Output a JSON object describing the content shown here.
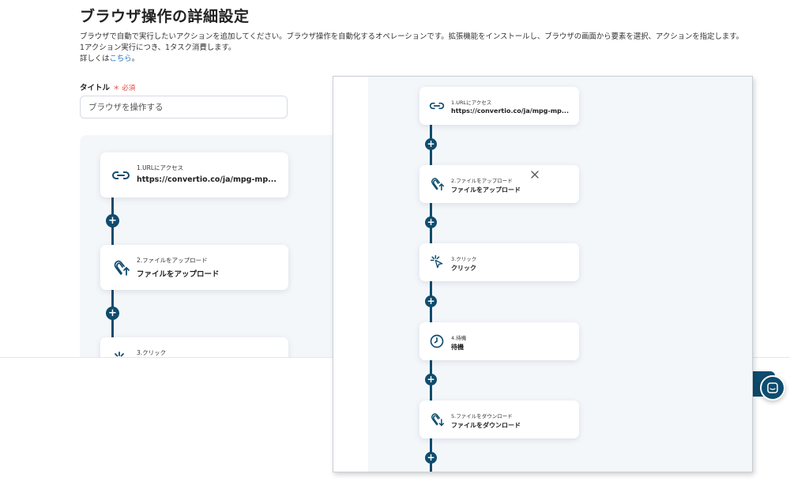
{
  "page": {
    "title": "ブラウザ操作の詳細設定",
    "description_lines": [
      "ブラウザで自動で実行したいアクションを追加してください。ブラウザ操作を自動化するオペレーションです。拡張機能をインストールし、ブラウザの画面から要素を選択、アクションを指定します。",
      "1アクション実行につき、1タスク消費します。"
    ],
    "details_prefix": "詳しくは",
    "details_link": "こちら",
    "details_suffix": "。"
  },
  "form": {
    "title_label": "タイトル",
    "required_mark": "＊ 必須",
    "title_value": "ブラウザを操作する"
  },
  "add_label": "+",
  "left_flow": {
    "steps": [
      {
        "num": "1.URLにアクセス",
        "name": "https://convertio.co/ja/mpg-mp...",
        "icon": "link-icon"
      },
      {
        "num": "2.ファイルをアップロード",
        "name": "ファイルをアップロード",
        "icon": "paperclip-upload-icon"
      },
      {
        "num": "3.クリック",
        "name": "",
        "icon": "click-icon"
      }
    ]
  },
  "overlay_flow": {
    "steps": [
      {
        "num": "1.URLにアクセス",
        "name": "https://convertio.co/ja/mpg-mp...",
        "icon": "link-icon"
      },
      {
        "num": "2.ファイルをアップロード",
        "name": "ファイルをアップロード",
        "icon": "paperclip-upload-icon"
      },
      {
        "num": "3.クリック",
        "name": "クリック",
        "icon": "click-icon"
      },
      {
        "num": "4.待機",
        "name": "待機",
        "icon": "clock-icon"
      },
      {
        "num": "5.ファイルをダウンロード",
        "name": "ファイルをダウンロード",
        "icon": "paperclip-download-icon"
      }
    ]
  },
  "colors": {
    "accent": "#0f4c6e",
    "canvas": "#f4f7fa",
    "required": "#e04848",
    "link": "#1a73c9"
  }
}
